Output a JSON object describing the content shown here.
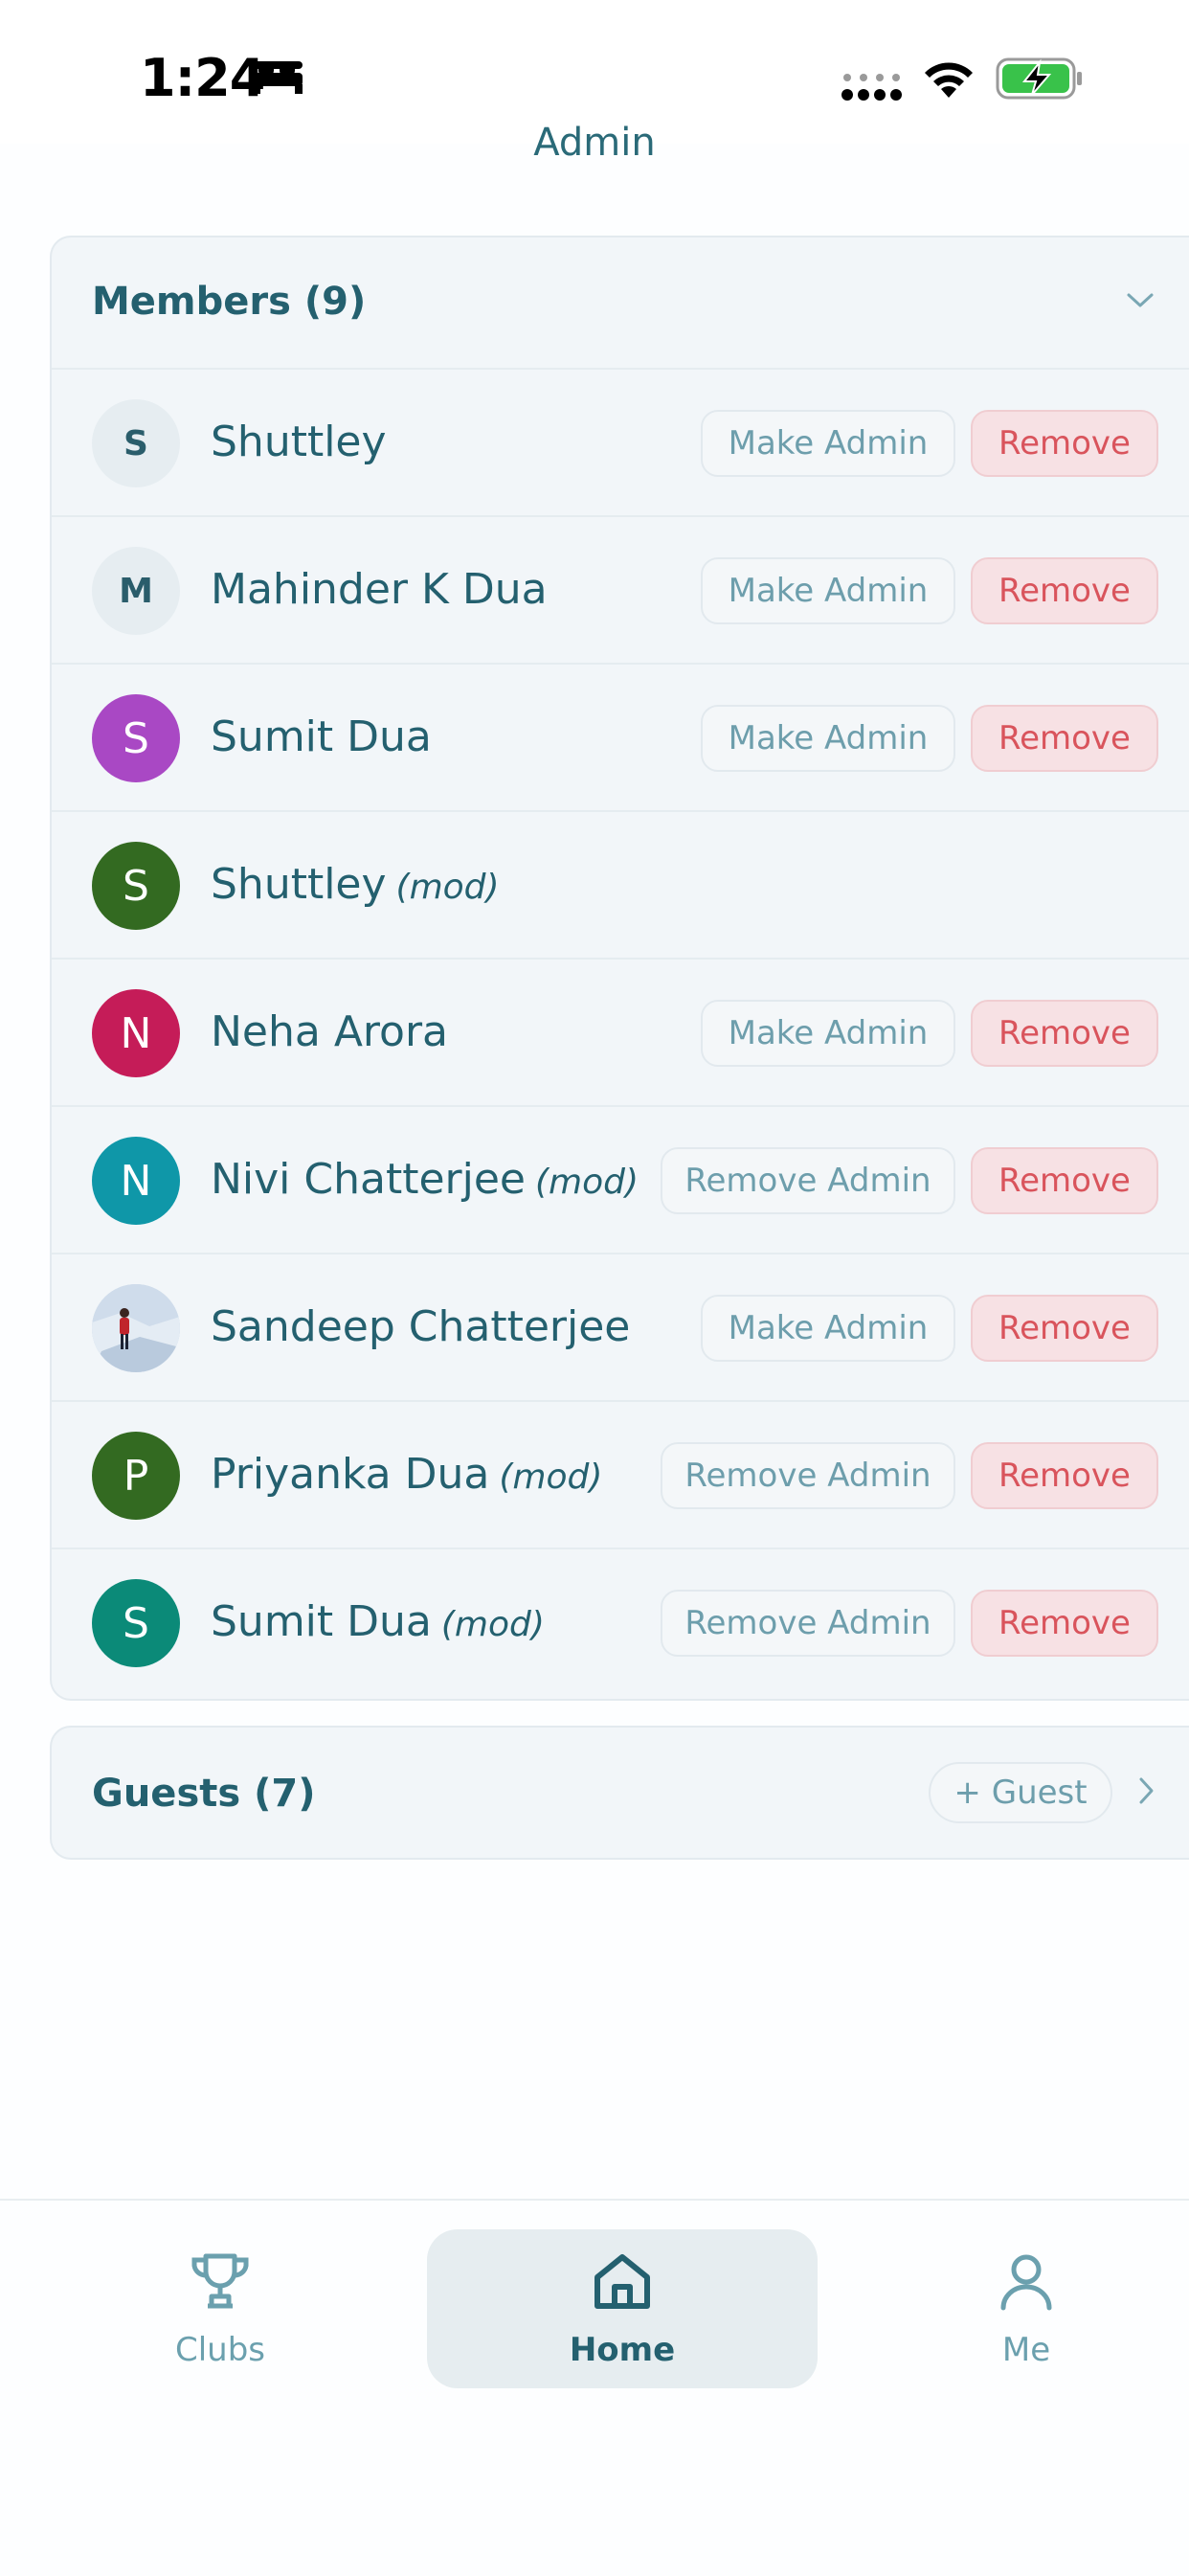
{
  "status_bar": {
    "time": "1:24",
    "icons": [
      "bed-icon",
      "cellular-signal-icon",
      "wifi-icon",
      "battery-charging-icon"
    ]
  },
  "header": {
    "title_partial": "Admin"
  },
  "members": {
    "title": "Members (9)",
    "rows": [
      {
        "initial": "S",
        "name": "Shuttley",
        "mod": "",
        "avatar_color": "#e6edf1",
        "admin_action": "Make Admin",
        "remove": "Remove"
      },
      {
        "initial": "M",
        "name": "Mahinder K Dua",
        "mod": "",
        "avatar_color": "#e6edf1",
        "admin_action": "Make Admin",
        "remove": "Remove"
      },
      {
        "initial": "S",
        "name": "Sumit Dua",
        "mod": "",
        "avatar_color": "#a948c4",
        "admin_action": "Make Admin",
        "remove": "Remove"
      },
      {
        "initial": "S",
        "name": "Shuttley",
        "mod": "(mod)",
        "avatar_color": "#336a21",
        "admin_action": "",
        "remove": ""
      },
      {
        "initial": "N",
        "name": "Neha Arora",
        "mod": "",
        "avatar_color": "#c51c58",
        "admin_action": "Make Admin",
        "remove": "Remove"
      },
      {
        "initial": "N",
        "name": "Nivi Chatterjee",
        "mod": "(mod)",
        "avatar_color": "#0f97a8",
        "admin_action": "Remove Admin",
        "remove": "Remove"
      },
      {
        "initial": "",
        "name": "Sandeep Chatterjee",
        "mod": "",
        "avatar_color": "#c7d7e6",
        "admin_action": "Make Admin",
        "remove": "Remove"
      },
      {
        "initial": "P",
        "name": "Priyanka Dua",
        "mod": "(mod)",
        "avatar_color": "#336a21",
        "admin_action": "Remove Admin",
        "remove": "Remove"
      },
      {
        "initial": "S",
        "name": "Sumit Dua",
        "mod": "(mod)",
        "avatar_color": "#0b8a78",
        "admin_action": "Remove Admin",
        "remove": "Remove"
      }
    ]
  },
  "guests": {
    "title": "Guests (7)",
    "add_label": "+ Guest"
  },
  "tab_bar": {
    "tabs": [
      {
        "label": "Clubs",
        "icon": "trophy-icon",
        "active": false
      },
      {
        "label": "Home",
        "icon": "home-icon",
        "active": true
      },
      {
        "label": "Me",
        "icon": "person-icon",
        "active": false
      }
    ]
  }
}
